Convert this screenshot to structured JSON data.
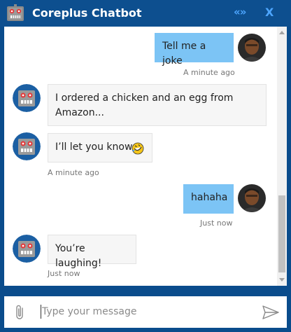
{
  "header": {
    "title": "Coreplus Chatbot",
    "collapse_label": "«»",
    "close_label": "X"
  },
  "messages": [
    {
      "sender": "user",
      "text": "Tell me a joke",
      "time": "A minute ago"
    },
    {
      "sender": "bot",
      "text": "I ordered a chicken and an egg from Amazon...",
      "line1": "I ordered a chicken and an egg from",
      "line2": "Amazon..."
    },
    {
      "sender": "bot",
      "text": "I’ll let you know",
      "time": "A minute ago",
      "emoji": "rolling-on-floor-laughing-emoji"
    },
    {
      "sender": "user",
      "text": "hahaha",
      "time": "Just now"
    },
    {
      "sender": "bot",
      "text": "You’re laughing!",
      "time": "Just now"
    }
  ],
  "composer": {
    "placeholder": "Type your message"
  },
  "icons": {
    "bot": "robot-icon",
    "attach": "paperclip-icon",
    "send": "send-icon"
  },
  "colors": {
    "header": "#0d4f8f",
    "header_buttons": "#4da6ff",
    "user_bubble": "#7cc4f5",
    "bot_bubble": "#f6f6f6"
  }
}
